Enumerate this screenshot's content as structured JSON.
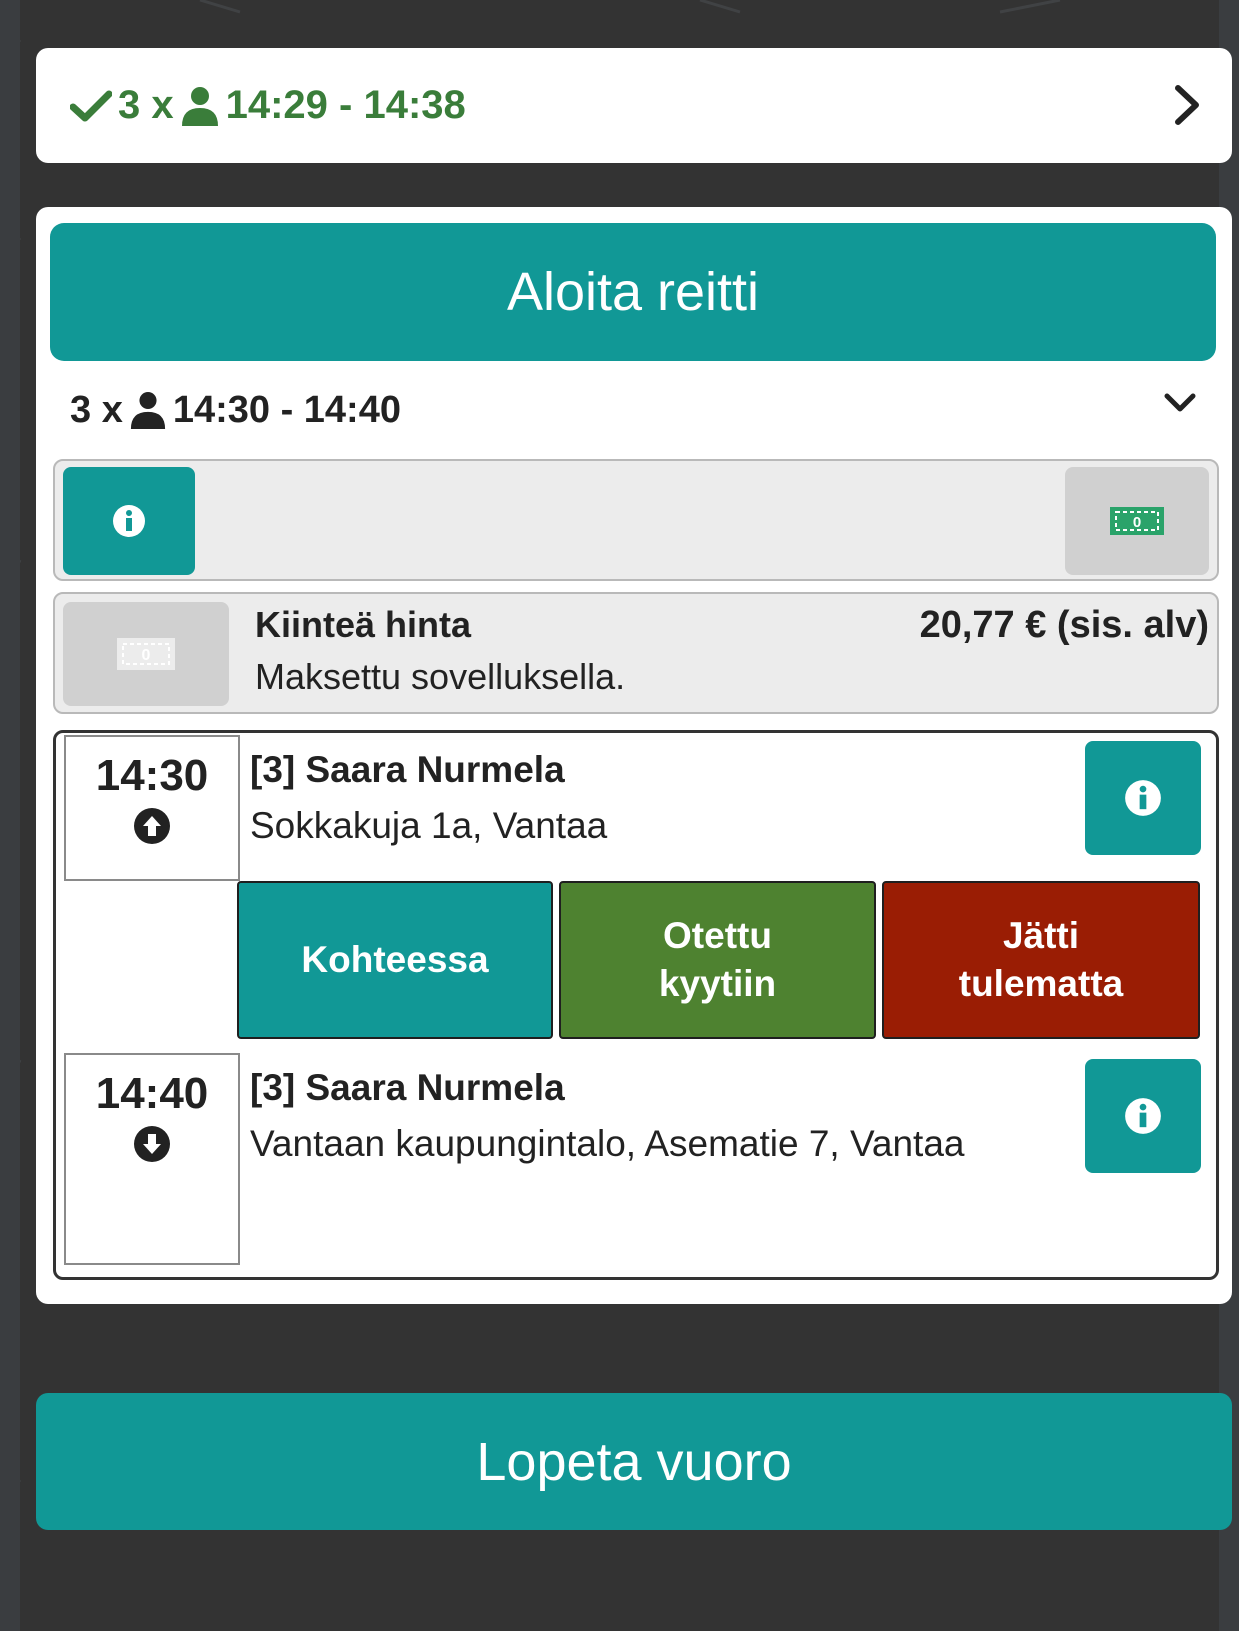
{
  "route_summary": {
    "count": "3 x",
    "time_range": "14:29 - 14:38",
    "status_color": "#3a7d3a"
  },
  "start_route_label": "Aloita reitti",
  "trip": {
    "count": "3 x",
    "time_range": "14:30 - 14:40"
  },
  "payment": {
    "icon_text": "0",
    "title": "Kiinteä hinta",
    "subtitle": "Maksettu sovelluksella.",
    "amount": "20,77 € (sis. alv)"
  },
  "stops": [
    {
      "time": "14:30",
      "direction": "pickup",
      "passenger": "[3] Saara Nurmela",
      "address": "Sokkakuja 1a, Vantaa"
    },
    {
      "time": "14:40",
      "direction": "dropoff",
      "passenger": "[3] Saara Nurmela",
      "address": "Vantaan kaupungintalo, Asematie 7, Vantaa"
    }
  ],
  "actions": {
    "arrived": "Kohteessa",
    "picked_up": "Otettu kyytiin",
    "no_show": "Jätti tulematta"
  },
  "end_shift_label": "Lopeta vuoro",
  "colors": {
    "accent": "#119896",
    "green": "#4e8230",
    "red": "#9a1d04"
  }
}
